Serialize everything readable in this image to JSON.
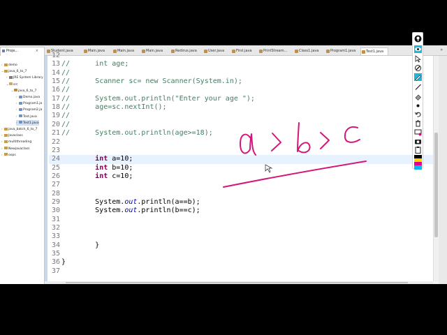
{
  "explorer": {
    "tab_label": "Proje...",
    "close": "×",
    "items": [
      {
        "label": "demo",
        "depth": 0,
        "arrow": "›",
        "icon": "project-icon",
        "selected": false
      },
      {
        "label": "java_6_to_7",
        "depth": 0,
        "arrow": "⌄",
        "icon": "project-icon",
        "selected": false
      },
      {
        "label": "JRE System Library",
        "depth": 1,
        "arrow": "›",
        "icon": "library-icon",
        "selected": false
      },
      {
        "label": "src",
        "depth": 1,
        "arrow": "⌄",
        "icon": "source-folder-icon",
        "selected": false
      },
      {
        "label": "java_6_to_7",
        "depth": 2,
        "arrow": "⌄",
        "icon": "package-icon",
        "selected": false
      },
      {
        "label": "Demo.java",
        "depth": 3,
        "arrow": "›",
        "icon": "java-file-icon",
        "selected": false
      },
      {
        "label": "Program1.ja",
        "depth": 3,
        "arrow": "›",
        "icon": "java-file-icon",
        "selected": false
      },
      {
        "label": "Program2.ja",
        "depth": 3,
        "arrow": "›",
        "icon": "java-file-icon",
        "selected": false
      },
      {
        "label": "Test.java",
        "depth": 3,
        "arrow": "›",
        "icon": "java-file-icon",
        "selected": false
      },
      {
        "label": "Test1.java",
        "depth": 3,
        "arrow": "›",
        "icon": "java-file-icon",
        "selected": true
      },
      {
        "label": "java_batch_6_to_7",
        "depth": 0,
        "arrow": "›",
        "icon": "project-icon",
        "selected": false
      },
      {
        "label": "Javaclass",
        "depth": 0,
        "arrow": "›",
        "icon": "project-icon",
        "selected": false
      },
      {
        "label": "multithreading",
        "depth": 0,
        "arrow": "›",
        "icon": "project-icon",
        "selected": false
      },
      {
        "label": "Newjavaclass",
        "depth": 0,
        "arrow": "›",
        "icon": "project-icon",
        "selected": false
      },
      {
        "label": "oops",
        "depth": 0,
        "arrow": "›",
        "icon": "project-icon",
        "selected": false
      }
    ]
  },
  "editor_tabs": [
    {
      "label": "Student.java",
      "active": false
    },
    {
      "label": "Main.java",
      "active": false
    },
    {
      "label": "Main.java",
      "active": false
    },
    {
      "label": "Main.java",
      "active": false
    },
    {
      "label": "Redirus.java",
      "active": false
    },
    {
      "label": "User.java",
      "active": false
    },
    {
      "label": "First.java",
      "active": false
    },
    {
      "label": "PrintStream...",
      "active": false
    },
    {
      "label": "Class1.java",
      "active": false
    },
    {
      "label": "Program1.java",
      "active": false
    },
    {
      "label": "Test1.java",
      "active": true
    }
  ],
  "tab_overflow": "»",
  "code_lines": [
    {
      "num": "12",
      "current": false,
      "segs": []
    },
    {
      "num": "13",
      "current": false,
      "segs": [
        {
          "t": "cmt",
          "v": "//"
        },
        {
          "t": "txt",
          "v": "      "
        },
        {
          "t": "cmt",
          "v": "int age;"
        }
      ]
    },
    {
      "num": "14",
      "current": false,
      "segs": [
        {
          "t": "cmt",
          "v": "//"
        }
      ]
    },
    {
      "num": "15",
      "current": false,
      "segs": [
        {
          "t": "cmt",
          "v": "//"
        },
        {
          "t": "txt",
          "v": "      "
        },
        {
          "t": "cmt",
          "v": "Scanner sc= new Scanner(System.in);"
        }
      ]
    },
    {
      "num": "16",
      "current": false,
      "segs": [
        {
          "t": "cmt",
          "v": "//"
        }
      ]
    },
    {
      "num": "17",
      "current": false,
      "segs": [
        {
          "t": "cmt",
          "v": "//"
        },
        {
          "t": "txt",
          "v": "      "
        },
        {
          "t": "cmt",
          "v": "System.out.println(\"Enter your age \");"
        }
      ]
    },
    {
      "num": "18",
      "current": false,
      "segs": [
        {
          "t": "cmt",
          "v": "//"
        },
        {
          "t": "txt",
          "v": "      "
        },
        {
          "t": "cmt",
          "v": "age=sc.nextInt();"
        }
      ]
    },
    {
      "num": "19",
      "current": false,
      "segs": [
        {
          "t": "cmt",
          "v": "//"
        }
      ]
    },
    {
      "num": "20",
      "current": false,
      "segs": [
        {
          "t": "cmt",
          "v": "//"
        }
      ]
    },
    {
      "num": "21",
      "current": false,
      "segs": [
        {
          "t": "cmt",
          "v": "//"
        },
        {
          "t": "txt",
          "v": "      "
        },
        {
          "t": "cmt",
          "v": "System.out.println(age>=18);"
        }
      ]
    },
    {
      "num": "22",
      "current": false,
      "segs": []
    },
    {
      "num": "23",
      "current": false,
      "segs": []
    },
    {
      "num": "24",
      "current": true,
      "segs": [
        {
          "t": "txt",
          "v": "        "
        },
        {
          "t": "kw",
          "v": "int"
        },
        {
          "t": "txt",
          "v": " a=10;"
        }
      ]
    },
    {
      "num": "25",
      "current": false,
      "segs": [
        {
          "t": "txt",
          "v": "        "
        },
        {
          "t": "kw",
          "v": "int"
        },
        {
          "t": "txt",
          "v": " b=10;"
        }
      ]
    },
    {
      "num": "26",
      "current": false,
      "segs": [
        {
          "t": "txt",
          "v": "        "
        },
        {
          "t": "kw",
          "v": "int"
        },
        {
          "t": "txt",
          "v": " c=10;"
        }
      ]
    },
    {
      "num": "27",
      "current": false,
      "segs": []
    },
    {
      "num": "28",
      "current": false,
      "segs": []
    },
    {
      "num": "29",
      "current": false,
      "segs": [
        {
          "t": "txt",
          "v": "        System."
        },
        {
          "t": "fld",
          "v": "out"
        },
        {
          "t": "txt",
          "v": ".println(a==b);"
        }
      ]
    },
    {
      "num": "30",
      "current": false,
      "segs": [
        {
          "t": "txt",
          "v": "        System."
        },
        {
          "t": "fld",
          "v": "out"
        },
        {
          "t": "txt",
          "v": ".println(b==c);"
        }
      ]
    },
    {
      "num": "31",
      "current": false,
      "segs": []
    },
    {
      "num": "32",
      "current": false,
      "segs": []
    },
    {
      "num": "33",
      "current": false,
      "segs": []
    },
    {
      "num": "34",
      "current": false,
      "segs": [
        {
          "t": "txt",
          "v": "        }"
        }
      ]
    },
    {
      "num": "35",
      "current": false,
      "segs": []
    },
    {
      "num": "36",
      "current": false,
      "segs": [
        {
          "t": "txt",
          "v": "}"
        }
      ]
    },
    {
      "num": "37",
      "current": false,
      "segs": []
    }
  ],
  "annotation_tools": [
    {
      "name": "logo-icon",
      "glyph": "logo"
    },
    {
      "name": "eye-icon",
      "glyph": "eye"
    },
    {
      "name": "cursor-icon",
      "glyph": "cursor"
    },
    {
      "name": "pen-icon",
      "glyph": "pen"
    },
    {
      "name": "highlighter-icon",
      "glyph": "hl"
    },
    {
      "name": "line-icon",
      "glyph": "line"
    },
    {
      "name": "eraser-icon",
      "glyph": "eraser"
    },
    {
      "name": "dot-icon",
      "glyph": "dot"
    },
    {
      "name": "undo-icon",
      "glyph": "undo"
    },
    {
      "name": "trash-icon",
      "glyph": "trash"
    },
    {
      "name": "board-icon",
      "glyph": "board"
    },
    {
      "name": "camera-icon",
      "glyph": "camera"
    },
    {
      "name": "clipboard-icon",
      "glyph": "clip"
    }
  ],
  "palette": [
    "#000000",
    "#ffd500",
    "#e0008a",
    "#00b7ff"
  ],
  "colors": {
    "ink": "#d4167a",
    "keyword": "#7f0055",
    "comment": "#3f7f5f",
    "field": "#0000c0"
  },
  "handwriting": "a > b > c"
}
